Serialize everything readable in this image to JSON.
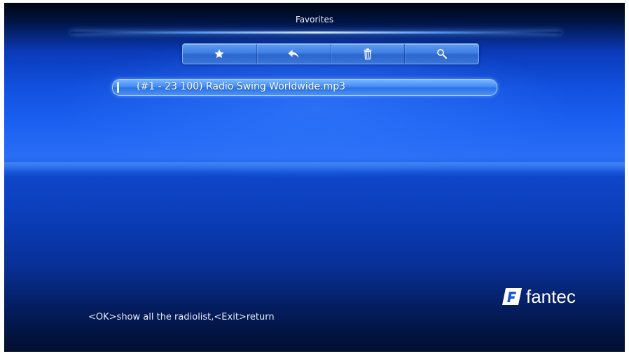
{
  "header": {
    "title": "Favorites"
  },
  "toolbar": {
    "buttons": [
      {
        "icon": "star-icon"
      },
      {
        "icon": "back-arrow-icon"
      },
      {
        "icon": "trash-icon"
      },
      {
        "icon": "search-icon"
      }
    ]
  },
  "list": {
    "items": [
      {
        "label": "(#1 - 23 100) Radio Swing Worldwide.mp3",
        "selected": true
      }
    ]
  },
  "footer": {
    "hint": "<OK>show all the radiolist,<Exit>return"
  },
  "brand": {
    "mark": "F",
    "name": "fantec"
  },
  "colors": {
    "background": "#1250de",
    "highlight": "#3d86f4",
    "text": "#ffffff"
  }
}
